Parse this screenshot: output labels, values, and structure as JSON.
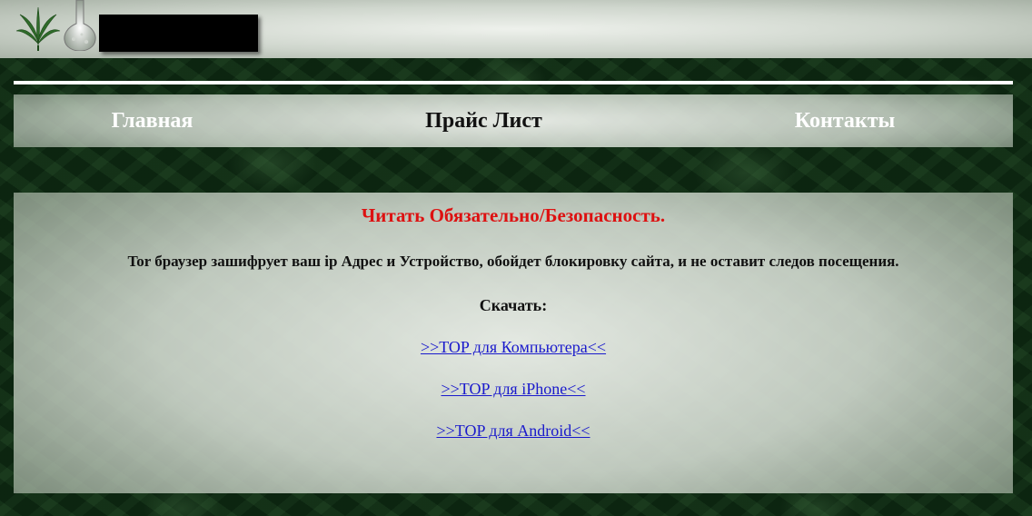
{
  "header": {
    "logo_leaf_icon": "cannabis-leaf-icon",
    "logo_flask_icon": "flask-icon",
    "redacted_box_color": "#000000"
  },
  "nav": {
    "items": [
      {
        "label": "Главная"
      },
      {
        "label": "Прайс Лист"
      },
      {
        "label": "Контакты"
      }
    ]
  },
  "content": {
    "title": "Читать Обязательно/Безопасность.",
    "title_color": "#dd1111",
    "description": "Tor браузер зашифрует ваш ip Адрес и Устройство, обойдет блокировку сайта, и не оставит следов посещения.",
    "download_label": "Скачать:",
    "links": [
      {
        "label": ">>TOP для Компьютера<<"
      },
      {
        "label": ">>TOP для iPhone<<"
      },
      {
        "label": ">>TOP для Android<<"
      }
    ],
    "link_color": "#1a1acc"
  }
}
